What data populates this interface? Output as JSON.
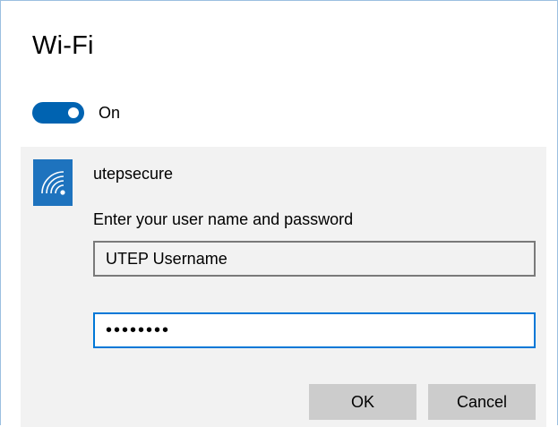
{
  "window": {
    "title": "Wi-Fi"
  },
  "wifi_toggle": {
    "state_label": "On",
    "is_on": true,
    "accent_color": "#0063b1"
  },
  "network": {
    "name": "utepsecure",
    "icon": "wifi-secured-icon",
    "tile_color": "#1e73be",
    "prompt": "Enter your user name and password",
    "username_value": "UTEP Username",
    "password_value": "••••••••"
  },
  "buttons": {
    "ok_label": "OK",
    "cancel_label": "Cancel"
  }
}
